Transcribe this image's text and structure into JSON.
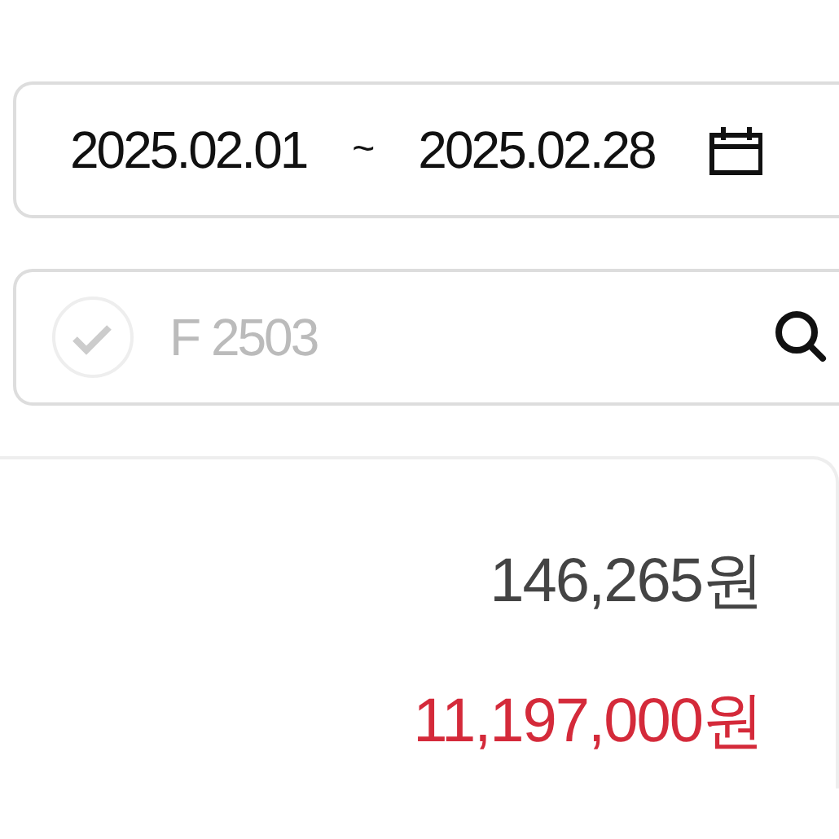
{
  "date_range": {
    "start": "2025.02.01",
    "separator": "~",
    "end": "2025.02.28"
  },
  "search": {
    "checked": false,
    "placeholder": "F 2503"
  },
  "summary": {
    "amounts": [
      {
        "text": "146,265원",
        "kind": "normal"
      },
      {
        "text": "11,197,000원",
        "kind": "highlight"
      }
    ]
  }
}
